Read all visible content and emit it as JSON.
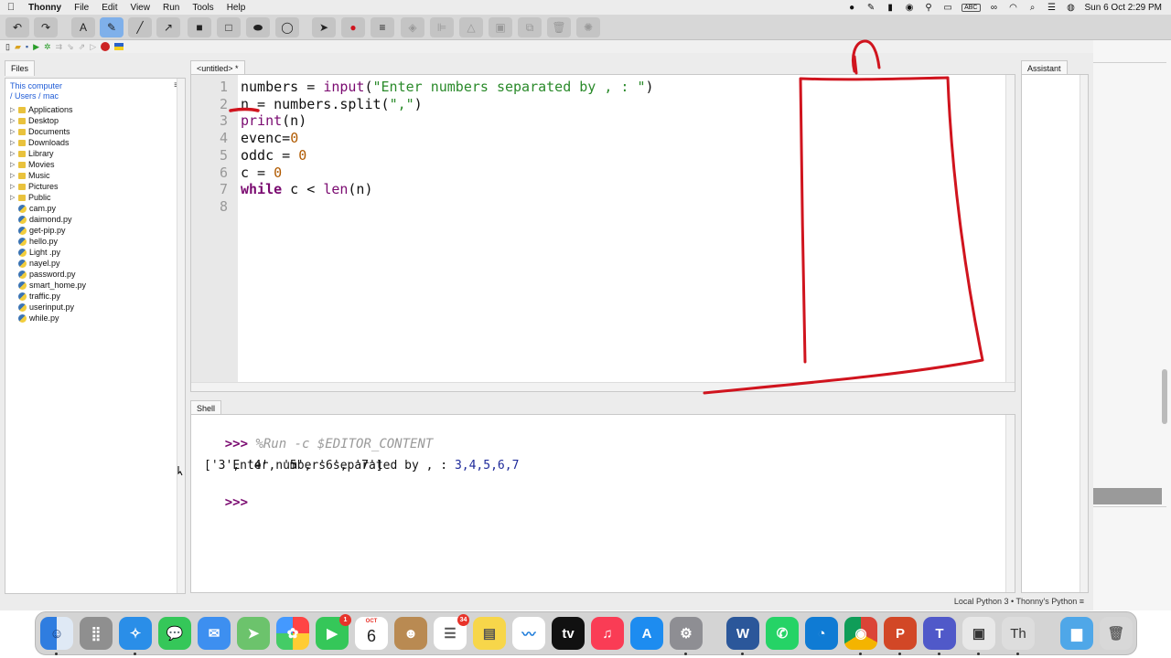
{
  "menubar": {
    "app_name": "Thonny",
    "menus": [
      "File",
      "Edit",
      "View",
      "Run",
      "Tools",
      "Help"
    ],
    "abc": "ABC",
    "datetime": "Sun 6 Oct  2:29 PM"
  },
  "panels": {
    "files_tab": "Files",
    "editor_tab": "<untitled> *",
    "shell_tab": "Shell",
    "assistant_tab": "Assistant"
  },
  "files": {
    "location_line1": "This computer",
    "location_line2": "/ Users / mac",
    "folders": [
      "Applications",
      "Desktop",
      "Documents",
      "Downloads",
      "Library",
      "Movies",
      "Music",
      "Pictures",
      "Public"
    ],
    "py_files": [
      "cam.py",
      "daimond.py",
      "get-pip.py",
      "hello.py",
      "Light .py",
      "nayel.py",
      "password.py",
      "smart_home.py",
      "traffic.py",
      "userinput.py",
      "while.py"
    ]
  },
  "editor": {
    "line_numbers": [
      "1",
      "2",
      "3",
      "4",
      "5",
      "6",
      "7",
      "8"
    ],
    "lines": [
      [
        {
          "t": "numbers = ",
          "c": ""
        },
        {
          "t": "input",
          "c": "bi"
        },
        {
          "t": "(",
          "c": ""
        },
        {
          "t": "\"Enter numbers separated by , : \"",
          "c": "str"
        },
        {
          "t": ")",
          "c": ""
        }
      ],
      [
        {
          "t": "n = numbers.split(",
          "c": ""
        },
        {
          "t": "\",\"",
          "c": "str"
        },
        {
          "t": ")",
          "c": ""
        }
      ],
      [
        {
          "t": "print",
          "c": "bi"
        },
        {
          "t": "(n)",
          "c": ""
        }
      ],
      [
        {
          "t": "evenc=",
          "c": ""
        },
        {
          "t": "0",
          "c": "num"
        }
      ],
      [
        {
          "t": "oddc = ",
          "c": ""
        },
        {
          "t": "0",
          "c": "num"
        }
      ],
      [
        {
          "t": "c = ",
          "c": ""
        },
        {
          "t": "0",
          "c": "num"
        }
      ],
      [
        {
          "t": "while",
          "c": "kw"
        },
        {
          "t": " c < ",
          "c": ""
        },
        {
          "t": "len",
          "c": "bi"
        },
        {
          "t": "(n)",
          "c": ""
        }
      ],
      []
    ]
  },
  "shell": {
    "prompt": ">>>",
    "run_command": "%Run -c $EDITOR_CONTENT",
    "input_prompt": "Enter numbers separated by , : ",
    "user_input": "3,4,5,6,7",
    "output": "['3', '4', '5', '6', '7']"
  },
  "status": {
    "interpreter": "Local Python 3  •  Thonny's Python"
  },
  "dock": {
    "calendar_month": "OCT",
    "calendar_day": "6",
    "facetime_badge": "1",
    "reminders_badge": "34",
    "tv_label": "tv",
    "word_label": "W",
    "textedit_label": "Th"
  },
  "colors": {
    "annotation_red": "#d0141e",
    "accent_blue": "#7fb0ea"
  }
}
